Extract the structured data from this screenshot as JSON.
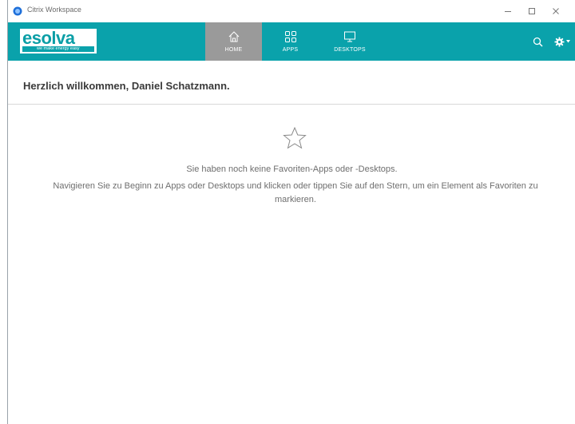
{
  "window": {
    "title": "Citrix Workspace"
  },
  "brand": {
    "logo_text": "esolva",
    "logo_tagline": "we make energy easy",
    "header_color": "#0aa2ab",
    "active_tab_color": "#9a9a9a"
  },
  "nav": {
    "tabs": [
      {
        "label": "HOME",
        "icon": "home-icon",
        "active": true
      },
      {
        "label": "APPS",
        "icon": "apps-grid-icon",
        "active": false
      },
      {
        "label": "DESKTOPS",
        "icon": "monitor-icon",
        "active": false
      }
    ]
  },
  "toolbar": {
    "search_icon": "search-icon",
    "settings_icon": "gear-icon"
  },
  "welcome": {
    "text": "Herzlich willkommen, Daniel Schatzmann."
  },
  "empty_state": {
    "icon": "star-outline-icon",
    "title": "Sie haben noch keine Favoriten-Apps oder -Desktops.",
    "description": "Navigieren Sie zu Beginn zu Apps oder Desktops und klicken oder tippen Sie auf den Stern, um ein Element als Favoriten zu markieren."
  }
}
